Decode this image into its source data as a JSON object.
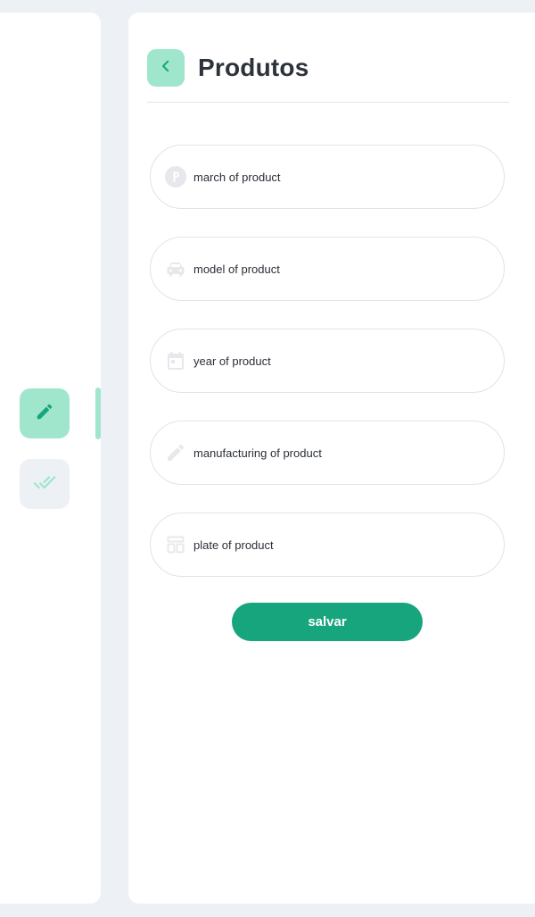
{
  "colors": {
    "accent_light": "#a0e6cd",
    "accent": "#16a57c",
    "background": "#edf0f4",
    "field_icon": "#e6e8ec"
  },
  "sidebar": {
    "items": [
      {
        "icon": "pencil-icon",
        "active": true
      },
      {
        "icon": "double-check-icon",
        "active": false
      }
    ]
  },
  "header": {
    "back_icon": "chevron-left-icon",
    "title": "Produtos"
  },
  "form": {
    "fields": [
      {
        "icon": "parking-icon",
        "placeholder": "march of product"
      },
      {
        "icon": "car-icon",
        "placeholder": "model of product"
      },
      {
        "icon": "calendar-icon",
        "placeholder": "year of product"
      },
      {
        "icon": "pencil-icon",
        "placeholder": "manufacturing of product"
      },
      {
        "icon": "layout-icon",
        "placeholder": "plate of product"
      }
    ],
    "save_label": "salvar"
  }
}
